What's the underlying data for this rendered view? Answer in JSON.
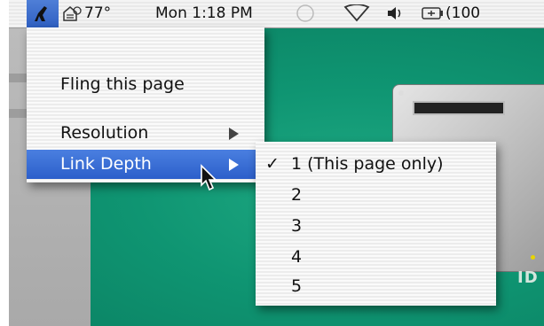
{
  "menubar": {
    "temperature": "77°",
    "clock": "Mon 1:18 PM",
    "battery": "(100"
  },
  "menu": {
    "items": [
      {
        "label": "Fling this page"
      },
      {
        "label": "Resolution"
      },
      {
        "label": "Link Depth"
      }
    ]
  },
  "submenu": {
    "items": [
      {
        "label": "1 (This page only)",
        "checked": true
      },
      {
        "label": "2"
      },
      {
        "label": "3"
      },
      {
        "label": "4"
      },
      {
        "label": "5"
      }
    ]
  },
  "desktop": {
    "label_partial": "ID"
  },
  "colors": {
    "highlight": "#2f62cc",
    "desktop": "#0f9572"
  }
}
